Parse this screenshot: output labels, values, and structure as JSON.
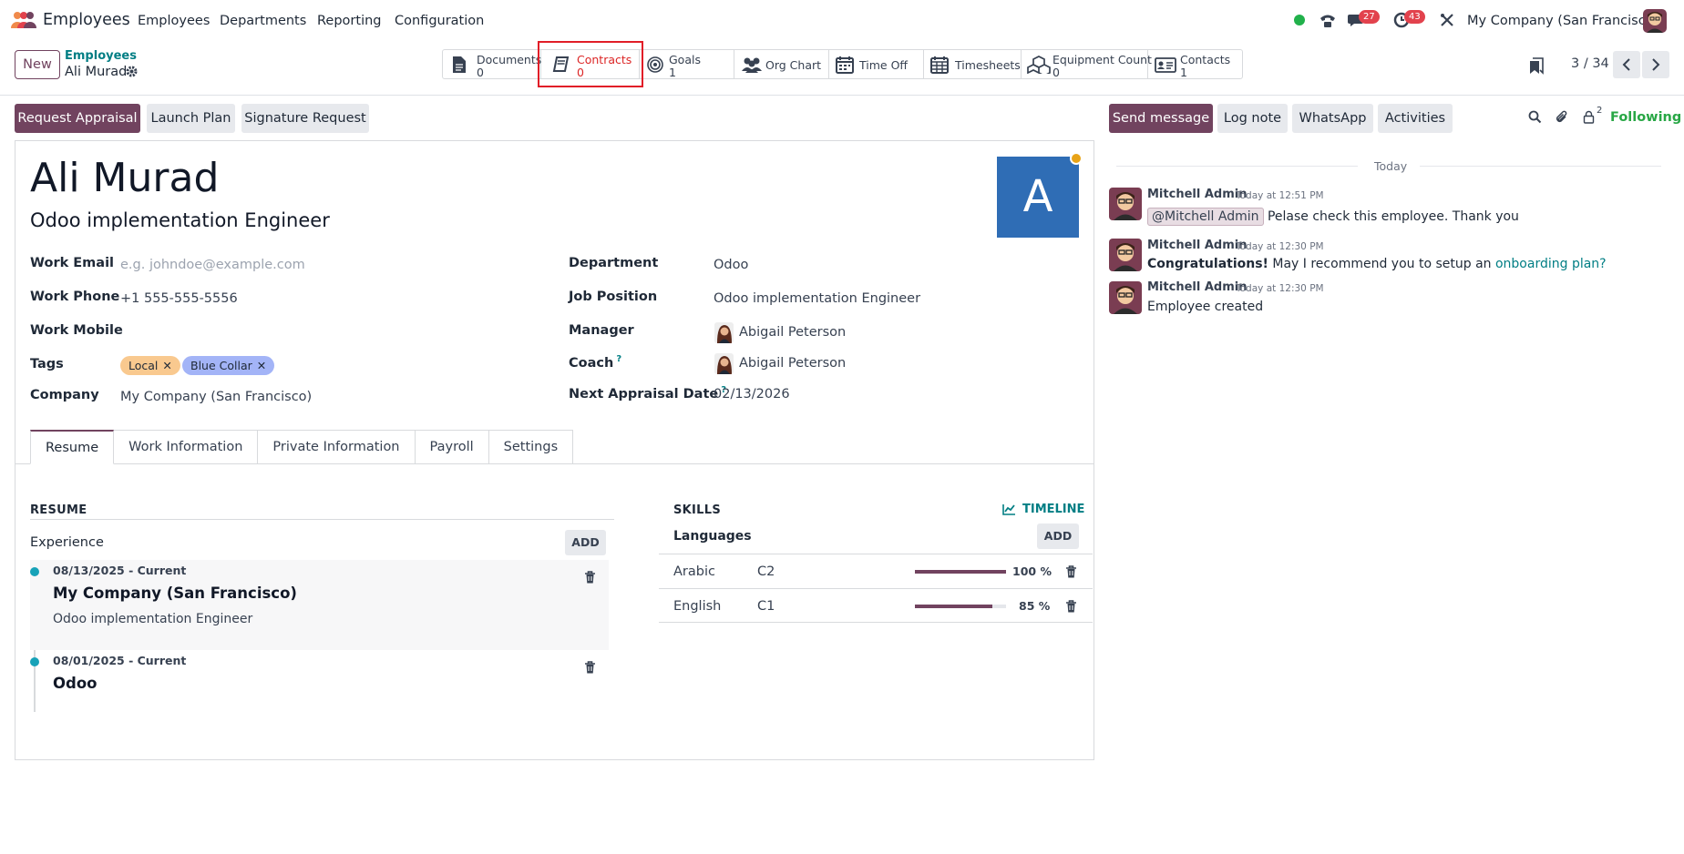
{
  "navbar": {
    "app_name": "Employees",
    "menu": [
      "Employees",
      "Departments",
      "Reporting",
      "Configuration"
    ],
    "messages_badge": "27",
    "activities_badge": "43",
    "company": "My Company (San Francisco)"
  },
  "breadcrumb": {
    "parent": "Employees",
    "current": "Ali Murad"
  },
  "control": {
    "new_label": "New"
  },
  "smart_buttons": {
    "documents": {
      "label": "Documents",
      "count": "0"
    },
    "contracts": {
      "label": "Contracts",
      "count": "0"
    },
    "goals": {
      "label": "Goals",
      "count": "1"
    },
    "org_chart": {
      "label": "Org Chart"
    },
    "time_off": {
      "label": "Time Off"
    },
    "timesheets": {
      "label": "Timesheets"
    },
    "equipment": {
      "label": "Equipment Count",
      "count": "0"
    },
    "contacts": {
      "label": "Contacts",
      "count": "1"
    }
  },
  "pager": {
    "text": "3 / 34"
  },
  "actions": {
    "request_appraisal": "Request Appraisal",
    "launch_plan": "Launch Plan",
    "signature_request": "Signature Request"
  },
  "employee": {
    "name": "Ali Murad",
    "job_title": "Odoo implementation Engineer",
    "avatar_letter": "A",
    "work_email_label": "Work Email",
    "work_email_placeholder": "e.g. johndoe@example.com",
    "work_phone_label": "Work Phone",
    "work_phone": "+1 555-555-5556",
    "work_mobile_label": "Work Mobile",
    "tags_label": "Tags",
    "tags": [
      "Local",
      "Blue Collar"
    ],
    "company_label": "Company",
    "company": "My Company (San Francisco)",
    "department_label": "Department",
    "department": "Odoo",
    "job_position_label": "Job Position",
    "job_position": "Odoo implementation Engineer",
    "manager_label": "Manager",
    "manager": "Abigail Peterson",
    "coach_label": "Coach",
    "coach": "Abigail Peterson",
    "next_appraisal_label": "Next Appraisal Date",
    "next_appraisal": "02/13/2026"
  },
  "tabs": [
    "Resume",
    "Work Information",
    "Private Information",
    "Payroll",
    "Settings"
  ],
  "resume": {
    "title": "RESUME",
    "experience_label": "Experience",
    "add_label": "ADD",
    "items": [
      {
        "date": "08/13/2025 - Current",
        "title": "My Company (San Francisco)",
        "desc": "Odoo implementation Engineer"
      },
      {
        "date": "08/01/2025 - Current",
        "title": "Odoo"
      }
    ]
  },
  "skills": {
    "title": "SKILLS",
    "timeline_label": "TIMELINE",
    "languages_label": "Languages",
    "add_label": "ADD",
    "rows": [
      {
        "name": "Arabic",
        "level": "C2",
        "percent": 100,
        "percent_label": "100 %"
      },
      {
        "name": "English",
        "level": "C1",
        "percent": 85,
        "percent_label": "85 %"
      }
    ]
  },
  "chatter": {
    "send_message": "Send message",
    "log_note": "Log note",
    "whatsapp": "WhatsApp",
    "activities": "Activities",
    "followers_count": "2",
    "following": "Following",
    "date_divider": "Today",
    "messages": [
      {
        "author": "Mitchell Admin",
        "time": "Today at 12:51 PM",
        "mention": "@Mitchell Admin",
        "body": "Pelase check this employee. Thank you"
      },
      {
        "author": "Mitchell Admin",
        "time": "Today at 12:30 PM",
        "bold": "Congratulations!",
        "body": "May I recommend you to setup an",
        "link": "onboarding plan?"
      },
      {
        "author": "Mitchell Admin",
        "time": "Today at 12:30 PM",
        "body": "Employee created"
      }
    ]
  },
  "colors": {
    "brand": "#71435f",
    "link": "#017e84",
    "highlight": "#e11d27",
    "tag_local": "#f9c98f",
    "tag_blue_collar": "#a3b4f7",
    "following": "#28a745"
  }
}
